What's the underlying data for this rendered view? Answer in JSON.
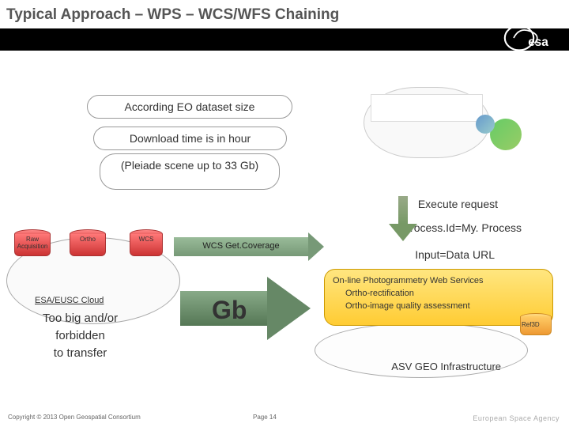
{
  "title": "Typical Approach – WPS – WCS/WFS Chaining",
  "bubbles": {
    "line1": "According EO dataset size",
    "line2": "Download time is in hour",
    "line3": "(Pleiade scene up to 33 Gb)"
  },
  "labels": {
    "execute": "Execute request",
    "process": "Process.Id=My. Process",
    "input": "Input=Data URL",
    "getcoverage": "WCS Get.Coverage",
    "gb": "Gb",
    "cloud": "ESA/EUSC Cloud",
    "toobig": "Too big and/or\nforbidden\nto transfer",
    "asv": "ASV GEO Infrastructure"
  },
  "dbs": {
    "raw": "Raw\nAcquisition",
    "ortho": "Ortho",
    "wcs": "WCS",
    "ref3d": "Ref3D"
  },
  "orange": {
    "l1": "On-line Photogrammetry Web Services",
    "l2": "Ortho-rectification",
    "l3": "Ortho-image quality assessment"
  },
  "footer": {
    "copyright": "Copyright © 2013 Open Geospatial Consortium",
    "page": "Page 14",
    "esa": "European Space Agency"
  }
}
